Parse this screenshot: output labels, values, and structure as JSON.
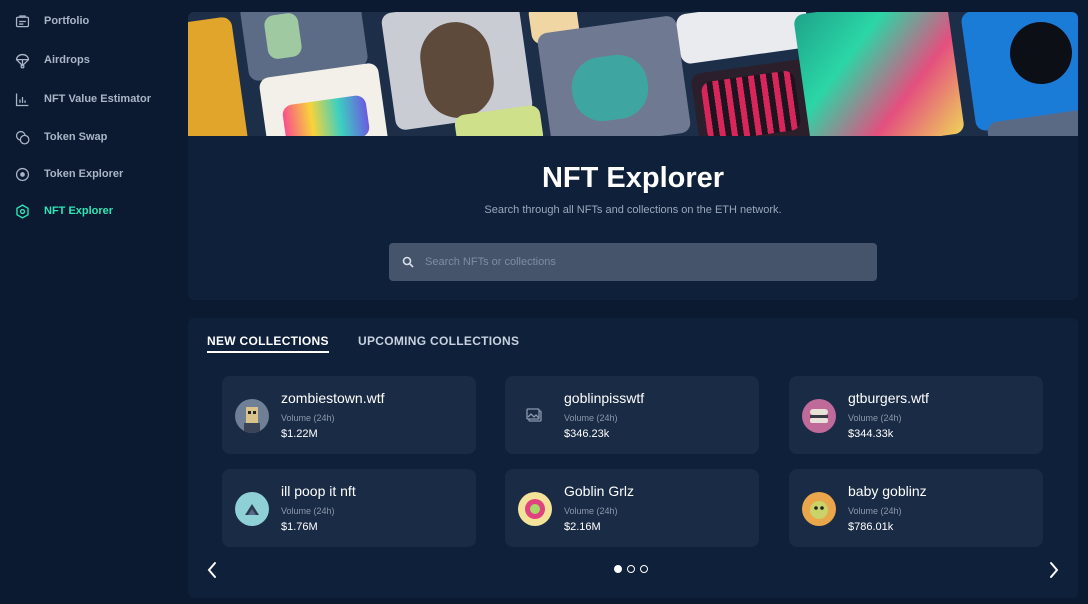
{
  "sidebar": {
    "items": [
      {
        "label": "Portfolio",
        "icon": "portfolio-icon"
      },
      {
        "label": "Airdrops",
        "icon": "parachute-icon"
      },
      {
        "label": "NFT Value Estimator",
        "icon": "chart-icon"
      },
      {
        "label": "Token Swap",
        "icon": "swap-icon"
      },
      {
        "label": "Token Explorer",
        "icon": "compass-icon"
      },
      {
        "label": "NFT Explorer",
        "icon": "hexagon-icon",
        "active": true
      }
    ]
  },
  "hero": {
    "title": "NFT Explorer",
    "subtitle": "Search through all NFTs and collections on the ETH network.",
    "search_placeholder": "Search NFTs or collections"
  },
  "tabs": [
    {
      "label": "NEW COLLECTIONS",
      "active": true
    },
    {
      "label": "UPCOMING COLLECTIONS",
      "active": false
    }
  ],
  "collections": [
    {
      "name": "zombiestown.wtf",
      "volume_label": "Volume (24h)",
      "volume": "$1.22M"
    },
    {
      "name": "goblinpisswtf",
      "volume_label": "Volume (24h)",
      "volume": "$346.23k"
    },
    {
      "name": "gtburgers.wtf",
      "volume_label": "Volume (24h)",
      "volume": "$344.33k"
    },
    {
      "name": "ill poop it nft",
      "volume_label": "Volume (24h)",
      "volume": "$1.76M"
    },
    {
      "name": "Goblin Grlz",
      "volume_label": "Volume (24h)",
      "volume": "$2.16M"
    },
    {
      "name": "baby goblinz",
      "volume_label": "Volume (24h)",
      "volume": "$786.01k"
    }
  ],
  "pagination": {
    "pages": 3,
    "current": 1
  },
  "colors": {
    "accent": "#2ee6b6",
    "background": "#0b1a31",
    "card": "#1a2b45"
  }
}
